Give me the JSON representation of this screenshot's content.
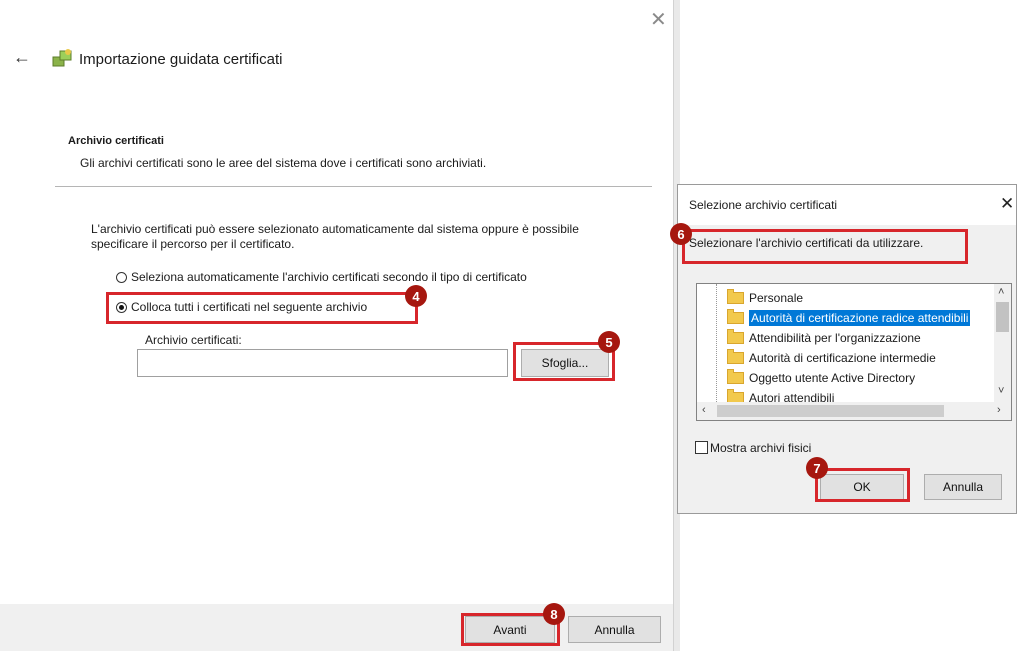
{
  "wizard": {
    "title": "Importazione guidata certificati",
    "section_title": "Archivio certificati",
    "section_desc": "Gli archivi certificati sono le aree del sistema dove i certificati sono archiviati.",
    "intro": "L'archivio certificati può essere selezionato automaticamente dal sistema oppure è possibile specificare il percorso per il certificato.",
    "radio_auto": "Seleziona automaticamente l'archivio certificati secondo il tipo di certificato",
    "radio_manual": "Colloca tutti i certificati nel seguente archivio",
    "archive_label": "Archivio certificati:",
    "archive_value": "",
    "browse_label": "Sfoglia...",
    "next_label": "Avanti",
    "cancel_label": "Annulla",
    "selected_option": "manual"
  },
  "dialog": {
    "title": "Selezione archivio certificati",
    "prompt": "Selezionare l'archivio certificati da utilizzare.",
    "items": [
      {
        "label": "Personale"
      },
      {
        "label": "Autorità di certificazione radice attendibili"
      },
      {
        "label": "Attendibilità per l'organizzazione"
      },
      {
        "label": "Autorità di certificazione intermedie"
      },
      {
        "label": "Oggetto utente Active Directory"
      },
      {
        "label": "Autori attendibili"
      }
    ],
    "selected_index": 1,
    "show_physical_label": "Mostra archivi fisici",
    "show_physical_checked": false,
    "ok_label": "OK",
    "cancel_label": "Annulla"
  },
  "annotations": {
    "badge_4": "4",
    "badge_5": "5",
    "badge_6": "6",
    "badge_7": "7",
    "badge_8": "8"
  },
  "colors": {
    "highlight_red": "#d7262b",
    "badge_red": "#a6170f",
    "selection_blue": "#0078d7"
  }
}
